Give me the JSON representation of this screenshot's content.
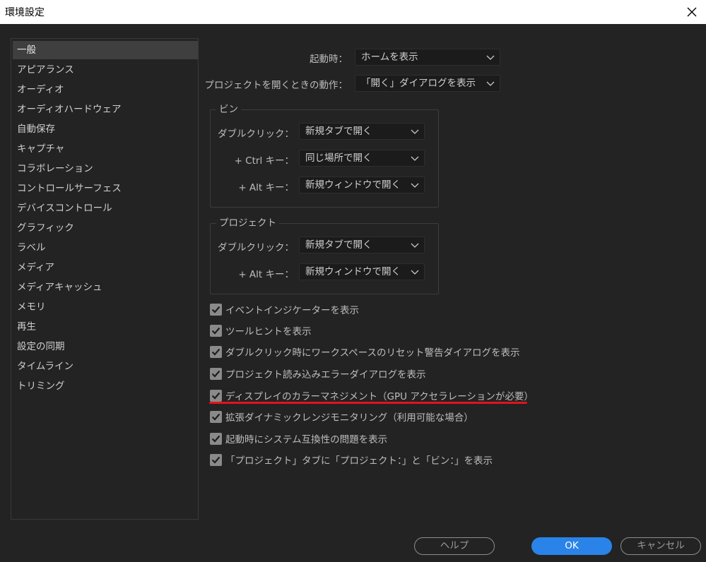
{
  "window": {
    "title": "環境設定",
    "close_icon": "close-icon"
  },
  "sidebar": {
    "items": [
      {
        "label": "一般",
        "selected": true
      },
      {
        "label": "アピアランス"
      },
      {
        "label": "オーディオ"
      },
      {
        "label": "オーディオハードウェア"
      },
      {
        "label": "自動保存"
      },
      {
        "label": "キャプチャ"
      },
      {
        "label": "コラボレーション"
      },
      {
        "label": "コントロールサーフェス"
      },
      {
        "label": "デバイスコントロール"
      },
      {
        "label": "グラフィック"
      },
      {
        "label": "ラベル"
      },
      {
        "label": "メディア"
      },
      {
        "label": "メディアキャッシュ"
      },
      {
        "label": "メモリ"
      },
      {
        "label": "再生"
      },
      {
        "label": "設定の同期"
      },
      {
        "label": "タイムライン"
      },
      {
        "label": "トリミング"
      }
    ]
  },
  "general": {
    "startup": {
      "label": "起動時：",
      "value": "ホームを表示"
    },
    "open_project": {
      "label": "プロジェクトを開くときの動作：",
      "value": "「開く」ダイアログを表示"
    },
    "bin_group": {
      "title": "ビン",
      "double_click": {
        "label": "ダブルクリック：",
        "value": "新規タブで開く"
      },
      "ctrl": {
        "label": "+ Ctrl キー：",
        "value": "同じ場所で開く"
      },
      "alt": {
        "label": "+ Alt キー：",
        "value": "新規ウィンドウで開く"
      }
    },
    "project_group": {
      "title": "プロジェクト",
      "double_click": {
        "label": "ダブルクリック：",
        "value": "新規タブで開く"
      },
      "alt": {
        "label": "+ Alt キー：",
        "value": "新規ウィンドウで開く"
      }
    },
    "checkboxes": [
      {
        "label": "イベントインジケーターを表示",
        "checked": true
      },
      {
        "label": "ツールヒントを表示",
        "checked": true
      },
      {
        "label": "ダブルクリック時にワークスペースのリセット警告ダイアログを表示",
        "checked": true
      },
      {
        "label": "プロジェクト読み込みエラーダイアログを表示",
        "checked": true
      },
      {
        "label": "ディスプレイのカラーマネジメント（GPU アクセラレーションが必要）",
        "checked": true
      },
      {
        "label": " 拡張ダイナミックレンジモニタリング（利用可能な場合）",
        "checked": true
      },
      {
        "label": "起動時にシステム互換性の問題を表示",
        "checked": true
      },
      {
        "label": "「プロジェクト」タブに「プロジェクト：」と「ビン：」を表示",
        "checked": true
      }
    ],
    "highlight_color": "#e0141e"
  },
  "buttons": {
    "help": "ヘルプ",
    "ok": "OK",
    "cancel": "キャンセル"
  },
  "colors": {
    "accent": "#2a83e8",
    "background": "#232323"
  }
}
